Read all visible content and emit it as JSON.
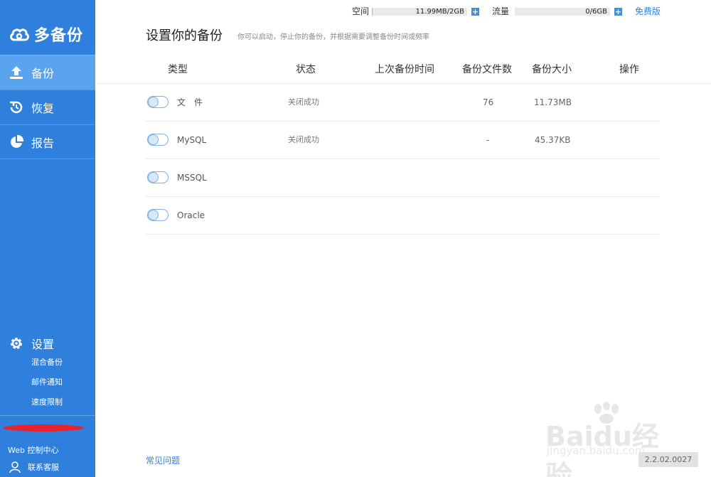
{
  "sidebar": {
    "logo_text": "多备份",
    "nav": [
      {
        "label": "备份",
        "icon": "upload-icon",
        "active": true
      },
      {
        "label": "恢复",
        "icon": "history-icon",
        "active": false
      },
      {
        "label": "报告",
        "icon": "pie-chart-icon",
        "active": false
      }
    ],
    "settings": {
      "label": "设置",
      "icon": "gear-icon",
      "items": [
        "混合备份",
        "邮件通知",
        "速度限制"
      ]
    },
    "web_console": "Web 控制中心",
    "support": "联系客服"
  },
  "quota": {
    "space_label": "空间",
    "space_value": "11.99MB/2GB",
    "space_fraction": 0.006,
    "traffic_label": "流量",
    "traffic_value": "0/6GB",
    "traffic_fraction": 0,
    "plan": "免费版"
  },
  "page": {
    "title": "设置你的备份",
    "subtitle": "你可以启动，停止你的备份，并根据需要调整备份时间或频率"
  },
  "table": {
    "headers": [
      "类型",
      "状态",
      "上次备份时间",
      "备份文件数",
      "备份大小",
      "操作"
    ],
    "rows": [
      {
        "type": "文　件",
        "status": "关闭成功",
        "last_backup": "",
        "file_count": "76",
        "size": "11.73MB",
        "enabled": false
      },
      {
        "type": "MySQL",
        "status": "关闭成功",
        "last_backup": "",
        "file_count": "-",
        "size": "45.37KB",
        "enabled": false
      },
      {
        "type": "MSSQL",
        "status": "",
        "last_backup": "",
        "file_count": "",
        "size": "",
        "enabled": false
      },
      {
        "type": "Oracle",
        "status": "",
        "last_backup": "",
        "file_count": "",
        "size": "",
        "enabled": false
      }
    ]
  },
  "footer": {
    "faq": "常见问题",
    "version": "2.2.02.0027"
  },
  "watermark": {
    "line1": "Baidu经验",
    "line2": "jingyan.baidu.com"
  },
  "colors": {
    "sidebar": "#2f7fdc",
    "sidebar_active": "#5aa3ee",
    "link": "#2f7fdc"
  }
}
